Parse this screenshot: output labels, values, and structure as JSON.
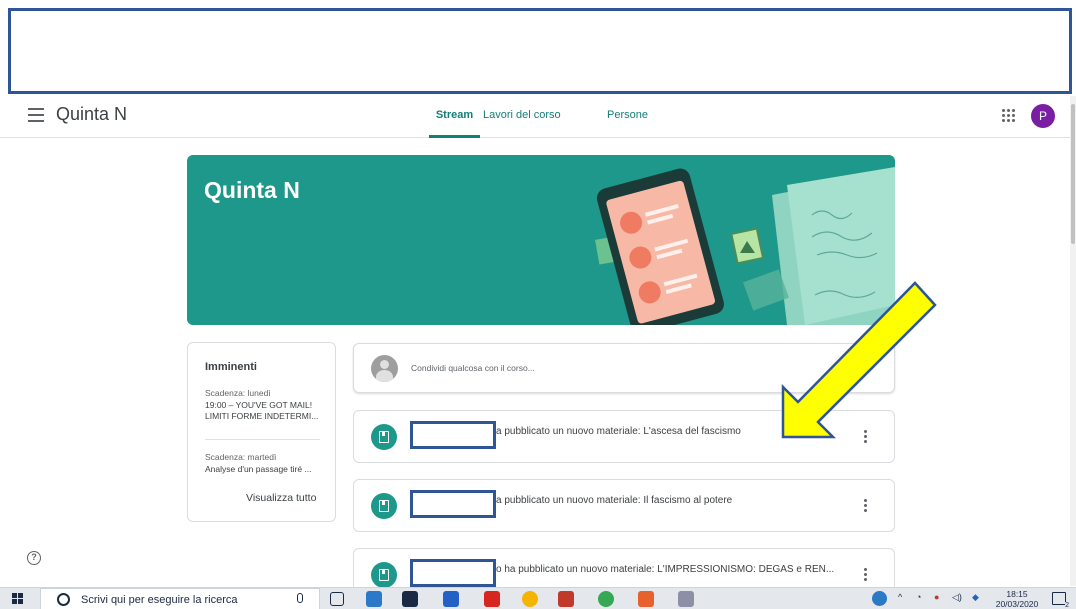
{
  "header": {
    "class_title": "Quinta N",
    "tabs": [
      {
        "label": "Stream",
        "active": true
      },
      {
        "label": "Lavori del corso",
        "active": false
      },
      {
        "label": "Persone",
        "active": false
      }
    ],
    "avatar_letter": "P"
  },
  "banner": {
    "title": "Quinta N",
    "color": "#1e988a"
  },
  "upcoming": {
    "title": "Imminenti",
    "items": [
      {
        "due": "Scadenza: lunedì",
        "text": "19:00 – YOU'VE GOT MAIL! LIMITI FORME INDETERMI..."
      },
      {
        "due": "Scadenza: martedì",
        "text": "Analyse d'un passage tiré ..."
      }
    ],
    "view_all": "Visualizza tutto"
  },
  "share": {
    "placeholder": "Condividi qualcosa con il corso..."
  },
  "posts": [
    {
      "text": "a pubblicato un nuovo materiale: L'ascesa del fascismo",
      "icon": "material-icon"
    },
    {
      "text": "a pubblicato un nuovo materiale: Il fascismo al potere",
      "icon": "material-icon"
    },
    {
      "text": "o ha pubblicato un nuovo materiale: L'IMPRESSIONISMO: DEGAS e REN...",
      "icon": "material-icon"
    }
  ],
  "taskbar": {
    "search_text": "Scrivi qui per eseguire la ricerca",
    "time": "18:15",
    "date": "20/03/2020",
    "notification_count": "2"
  },
  "colors": {
    "accent": "#137e76",
    "redaction_frame": "#2f5597",
    "arrow": "#ffff00"
  }
}
